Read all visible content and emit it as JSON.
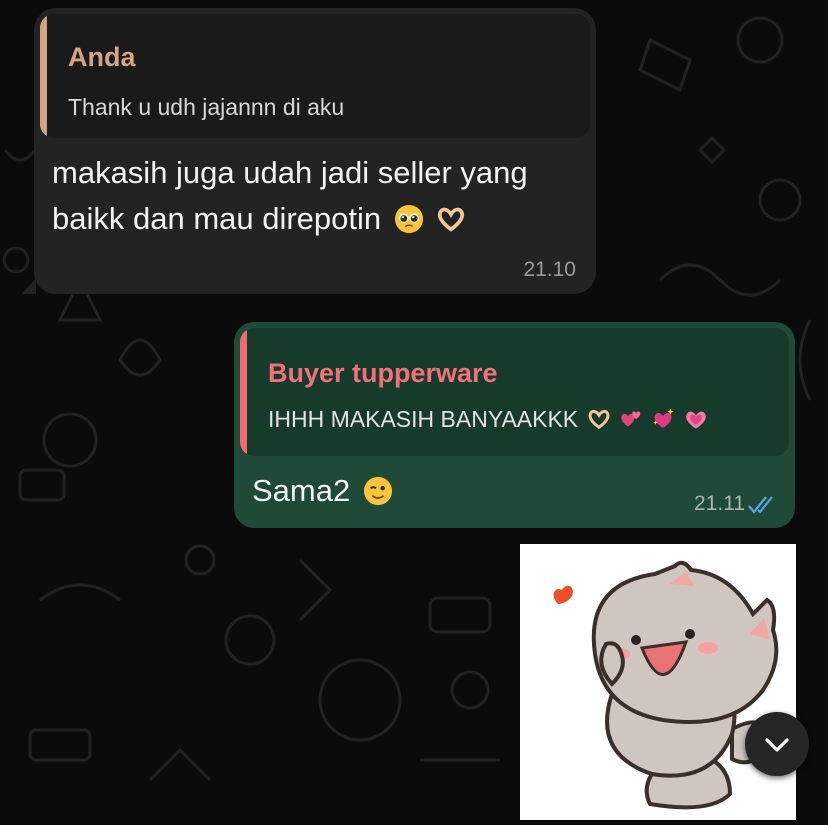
{
  "chat": {
    "incoming": {
      "reply_to": {
        "name": "Anda",
        "text": "Thank u udh jajannn di aku"
      },
      "text": "makasih juga udah jadi seller yang baikk dan mau direpotin",
      "emojis": [
        "pleading-face-emoji",
        "heart-hands-emoji"
      ],
      "time": "21.10"
    },
    "outgoing": {
      "reply_to": {
        "name": "Buyer tupperware",
        "text": "IHHH MAKASIH BANYAAKKK",
        "emojis": [
          "heart-hands-emoji",
          "two-hearts-emoji",
          "sparkling-heart-emoji",
          "growing-heart-emoji"
        ]
      },
      "text": "Sama2",
      "emojis": [
        "winking-face-emoji"
      ],
      "time": "21.11",
      "status": "read"
    },
    "sticker": {
      "icon": "cat-sticker"
    },
    "scroll_button": {
      "icon": "chevron-down-icon"
    }
  },
  "colors": {
    "incoming_bubble": "#232323",
    "outgoing_bubble": "#1f4a37",
    "incoming_quote_accent": "#d3a586",
    "outgoing_quote_accent": "#f0717a",
    "read_ticks": "#53a6e8"
  }
}
